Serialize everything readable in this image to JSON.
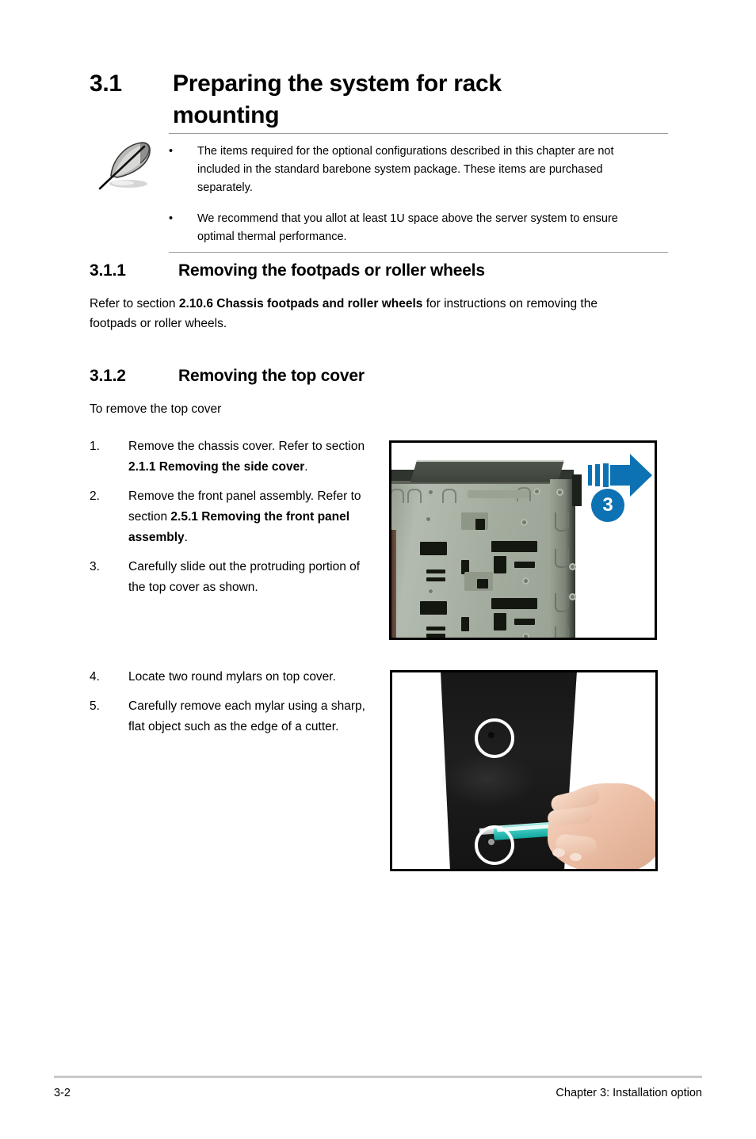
{
  "page": {
    "section_number": "3.1",
    "section_title": "Preparing the system for rack mounting"
  },
  "note": {
    "icon": "quill-pen-icon",
    "bullet_glyph": "•",
    "items": [
      "The items required for the optional configurations described in this chapter are not included in the standard barebone system package. These items are purchased separately.",
      "We recommend that you allot at least 1U space above the server system to ensure optimal thermal performance."
    ]
  },
  "subsection_311": {
    "number": "3.1.1",
    "title": "Removing the footpads or roller wheels",
    "paragraph_prefix": "Refer to section ",
    "paragraph_bold": "2.10.6 Chassis footpads and roller wheels",
    "paragraph_suffix": " for instructions on removing the footpads or roller wheels."
  },
  "subsection_312": {
    "number": "3.1.2",
    "title": "Removing the top cover",
    "intro": "To remove the top cover",
    "steps_group_a": [
      {
        "num": "1.",
        "prefix": "Remove the chassis cover. Refer to section ",
        "bold": "2.1.1 Removing the side cover",
        "suffix": "."
      },
      {
        "num": "2.",
        "prefix": "Remove the front panel assembly. Refer to section ",
        "bold": "2.5.1 Removing the front panel assembly",
        "suffix": "."
      },
      {
        "num": "3.",
        "prefix": "Carefully slide out the protruding portion of the top cover as shown.",
        "bold": "",
        "suffix": ""
      }
    ],
    "steps_group_b": [
      {
        "num": "4.",
        "prefix": "Locate two round mylars on top cover.",
        "bold": "",
        "suffix": ""
      },
      {
        "num": "5.",
        "prefix": "Carefully remove each mylar using a sharp, flat object such as the edge of a cutter.",
        "bold": "",
        "suffix": ""
      }
    ]
  },
  "figures": {
    "figure_1": {
      "name": "chassis-top-cover-slide-photo",
      "callout_number": "3",
      "callout_color": "#0d72b3",
      "arrow": "right-arrow-icon"
    },
    "figure_2": {
      "name": "mylar-removal-photo",
      "highlight_rings": 2
    }
  },
  "footer": {
    "page_number": "3-2",
    "chapter_label": "Chapter 3:  Installation option"
  }
}
